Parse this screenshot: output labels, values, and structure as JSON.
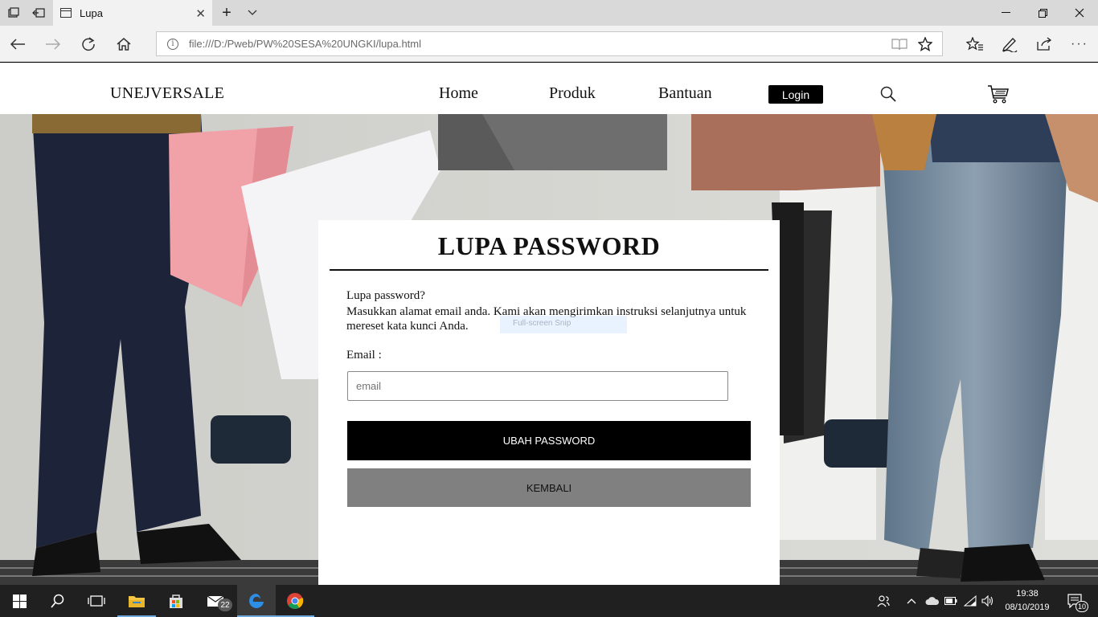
{
  "browser": {
    "tab_title": "Lupa",
    "url": "file:///D:/Pweb/PW%20SESA%20UNGKI/lupa.html"
  },
  "site": {
    "brand": "UNEJVERSALE",
    "nav": [
      "Home",
      "Produk",
      "Bantuan"
    ],
    "login_label": "Login"
  },
  "form": {
    "title": "LUPA PASSWORD",
    "question": "Lupa password?",
    "description": "Masukkan alamat email anda. Kami akan mengirimkan instruksi selanjutnya untuk mereset kata kunci Anda.",
    "email_label": "Email :",
    "email_placeholder": "email",
    "submit_label": "UBAH PASSWORD",
    "back_label": "KEMBALI",
    "ghost_overlay_text": "Full-screen Snip"
  },
  "taskbar": {
    "mail_badge": "22",
    "time": "19:38",
    "date": "08/10/2019",
    "notification_count": "10"
  },
  "colors": {
    "accent_blue": "#0078d7",
    "button_primary": "#000000",
    "button_secondary": "#808080"
  }
}
